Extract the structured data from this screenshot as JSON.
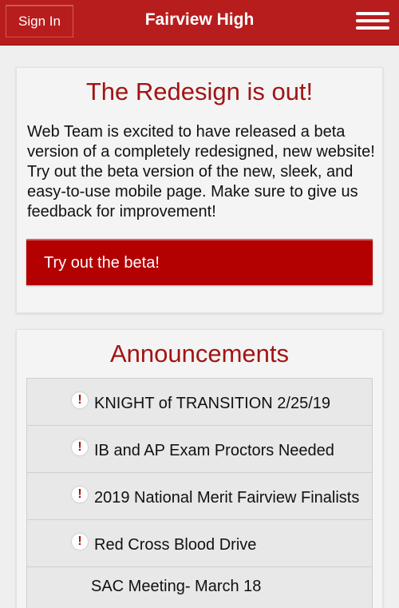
{
  "header": {
    "signin_label": "Sign In",
    "title": "Fairview High",
    "menu_icon": "hamburger-menu-icon",
    "brand_color": "#b81d1d"
  },
  "redesign": {
    "title": "The Redesign is out!",
    "body": "Web Team is excited to have released a beta version of a completely redesigned, new website! Try out the beta version of the new, sleek, and easy-to-use mobile page. Make sure to give us feedback for improvement!",
    "button_label": "Try out the beta!"
  },
  "announcements": {
    "title": "Announcements",
    "items": [
      {
        "text": "KNIGHT of TRANSITION 2/25/19",
        "alert": true
      },
      {
        "text": "IB and AP Exam Proctors Needed",
        "alert": true
      },
      {
        "text": "2019 National Merit Fairview Finalists",
        "alert": true
      },
      {
        "text": "Red Cross Blood Drive",
        "alert": true
      },
      {
        "text": "SAC Meeting- March 18",
        "alert": false
      }
    ],
    "alert_icon": "exclamation-icon"
  }
}
